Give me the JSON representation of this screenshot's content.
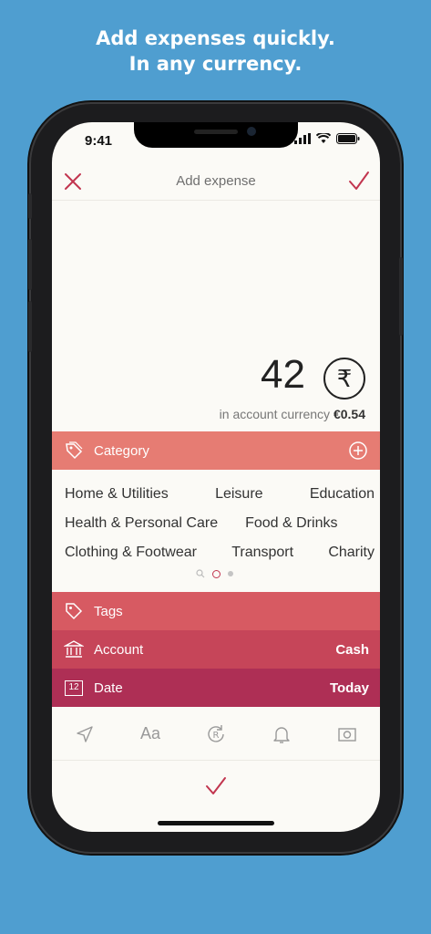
{
  "promo": {
    "line1": "Add expenses quickly.",
    "line2": "In any currency."
  },
  "status_bar": {
    "time": "9:41"
  },
  "header": {
    "title": "Add expense"
  },
  "amount": {
    "value": "42",
    "currency_symbol": "₹",
    "account_label": "in account currency",
    "account_value": "€0.54"
  },
  "category": {
    "label": "Category",
    "rows": [
      [
        "Home & Utilities",
        "Leisure",
        "Education"
      ],
      [
        "Health & Personal Care",
        "Food & Drinks"
      ],
      [
        "Clothing & Footwear",
        "Transport",
        "Charity"
      ]
    ]
  },
  "fields": {
    "tags": {
      "label": "Tags"
    },
    "account": {
      "label": "Account",
      "value": "Cash"
    },
    "date": {
      "label": "Date",
      "value": "Today",
      "icon_text": "12"
    }
  },
  "toolbar": {
    "text_icon": "Aa"
  },
  "colors": {
    "category": "#e67c73",
    "tags": "#d75a62",
    "account": "#c64559",
    "date": "#ae2f55",
    "accent": "#c2354f"
  },
  "icons": [
    "close-icon",
    "check-icon",
    "rupee-icon",
    "tag-icon",
    "add-circle-icon",
    "bank-icon",
    "calendar-icon",
    "location-icon",
    "text-icon",
    "recurring-icon",
    "bell-icon",
    "camera-icon"
  ]
}
